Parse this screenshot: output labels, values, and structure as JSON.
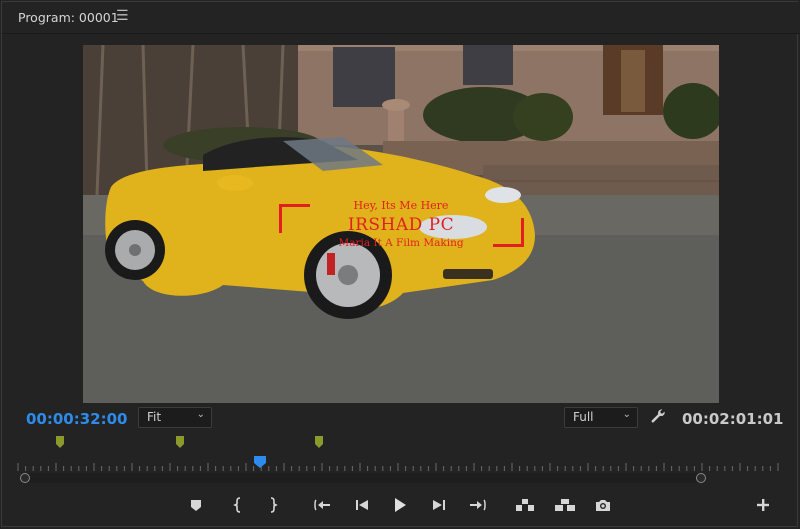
{
  "panel": {
    "title": "Program: 00001",
    "menu_glyph": "☰"
  },
  "overlay": {
    "line1": "Hey, Its Me Here",
    "line2": "IRSHAD PC",
    "line3": "Maria It A Film Making",
    "color": "#e21f1f"
  },
  "timecode": {
    "current": "00:00:32:00",
    "duration": "00:02:01:01",
    "current_color": "#2d8ceb"
  },
  "zoom_select": {
    "value": "Fit"
  },
  "resolution_select": {
    "value": "Full"
  },
  "icons": {
    "settings": "wrench-icon",
    "markers": "marker-icon"
  },
  "playhead_fraction": 0.313,
  "controls": [
    {
      "name": "add-marker-button",
      "icon": "marker-icon"
    },
    {
      "name": "mark-in-button",
      "icon": "mark-in-icon"
    },
    {
      "name": "mark-out-button",
      "icon": "mark-out-icon"
    },
    {
      "name": "go-to-in-button",
      "icon": "go-to-in-icon"
    },
    {
      "name": "step-back-button",
      "icon": "step-back-icon"
    },
    {
      "name": "play-button",
      "icon": "play-icon"
    },
    {
      "name": "step-forward-button",
      "icon": "step-forward-icon"
    },
    {
      "name": "go-to-out-button",
      "icon": "go-to-out-icon"
    },
    {
      "name": "lift-button",
      "icon": "lift-icon"
    },
    {
      "name": "extract-button",
      "icon": "extract-icon"
    },
    {
      "name": "export-frame-button",
      "icon": "camera-icon"
    },
    {
      "name": "button-editor-button",
      "icon": "plus-icon"
    }
  ]
}
